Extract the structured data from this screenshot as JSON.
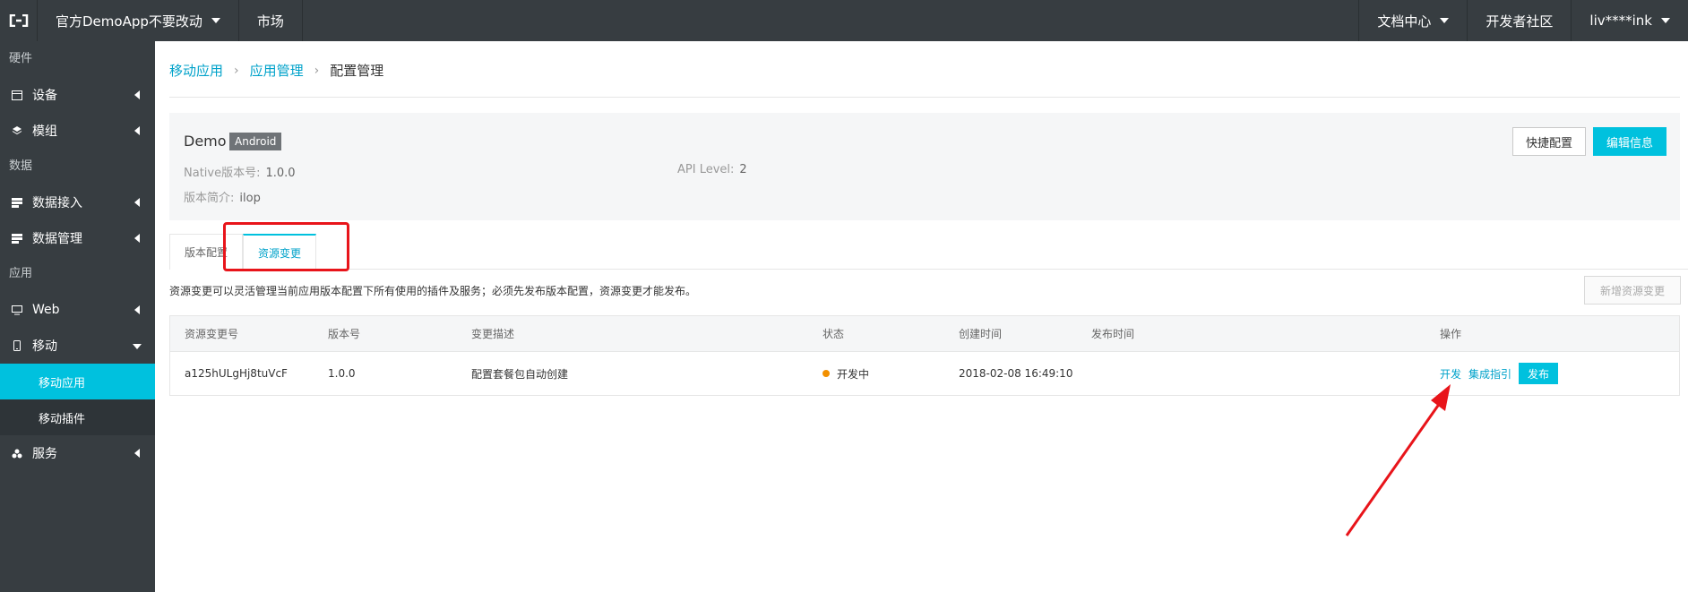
{
  "topbar": {
    "project": "官方DemoApp不要改动",
    "market": "市场",
    "docs": "文档中心",
    "community": "开发者社区",
    "user": "liv****ink"
  },
  "sidebar": {
    "groups": [
      {
        "title": "硬件"
      },
      {
        "title": "数据"
      },
      {
        "title": "应用"
      }
    ],
    "items": {
      "device": "设备",
      "module": "模组",
      "data_access": "数据接入",
      "data_manage": "数据管理",
      "web": "Web",
      "mobile": "移动",
      "mobile_app": "移动应用",
      "mobile_plugin": "移动插件",
      "service": "服务"
    }
  },
  "breadcrumb": [
    "移动应用",
    "应用管理",
    "配置管理"
  ],
  "app": {
    "name": "Demo",
    "platform": "Android",
    "native_label": "Native版本号:",
    "native_value": "1.0.0",
    "api_label": "API Level:",
    "api_value": "2",
    "desc_label": "版本简介:",
    "desc_value": "ilop",
    "btn_quick": "快捷配置",
    "btn_edit": "编辑信息"
  },
  "tabs": [
    "版本配置",
    "资源变更"
  ],
  "resource": {
    "description": "资源变更可以灵活管理当前应用版本配置下所有使用的插件及服务；必须先发布版本配置，资源变更才能发布。",
    "add_button": "新增资源变更"
  },
  "table": {
    "headers": [
      "资源变更号",
      "版本号",
      "变更描述",
      "状态",
      "创建时间",
      "发布时间",
      "操作"
    ],
    "rows": [
      {
        "id": "a125hULgHj8tuVcF",
        "version": "1.0.0",
        "description": "配置套餐包自动创建",
        "status": "开发中",
        "created": "2018-02-08 16:49:10",
        "published": "",
        "ops": [
          "开发",
          "集成指引",
          "发布"
        ]
      }
    ]
  },
  "colors": {
    "accent": "#00c1de",
    "link": "#00a2ca",
    "sidebar_bg": "#373d41",
    "status_dev": "#f29000",
    "annotation": "#e8141a"
  }
}
